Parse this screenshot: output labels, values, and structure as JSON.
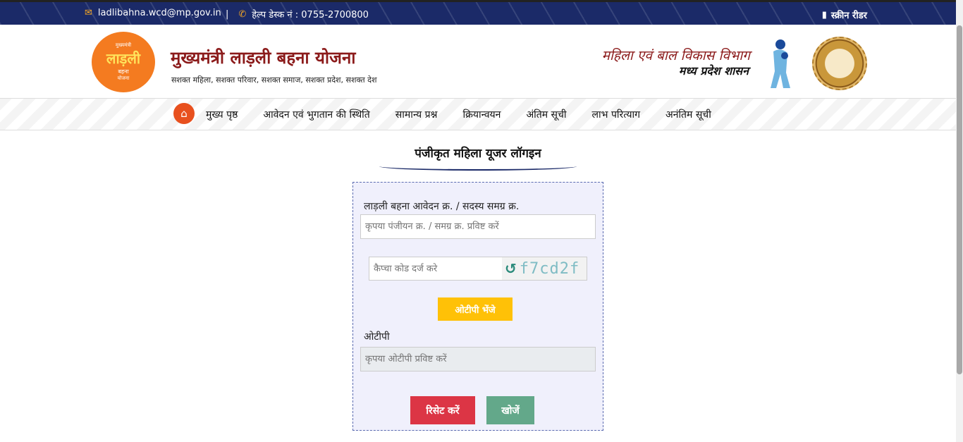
{
  "topbar": {
    "email_icon": "envelope-icon",
    "email": "ladlibahna.wcd@mp.gov.in",
    "separator": "|",
    "phone_icon": "phone-icon",
    "helpdesk": "हेल्प डेस्क नं : 0755-2700800",
    "screen_reader_icon": "book-icon",
    "screen_reader": "स्क्रीन रीडर",
    "background_color": "#1b2a68",
    "icon_color": "#f5a623"
  },
  "header": {
    "logo": {
      "line1": "मुख्यमंत्री",
      "line2": "लाड़ली",
      "line3": "बहना",
      "line4": "योजना"
    },
    "title": "मुख्यमंत्री लाड़ली बहना योजना",
    "tagline": "सशक्त महिला, सशक्त परिवार, सशक्त समाज, सशक्त प्रदेश, सशक्त देश",
    "dept_title": "महिला एवं बाल विकास विभाग",
    "dept_subtitle": "मध्य प्रदेश शासन",
    "title_color": "#8b1a1a",
    "logo_color": "#f47b20"
  },
  "nav": {
    "home_icon": "home-icon",
    "items": [
      "मुख्य पृष्ठ",
      "आवेदन एवं भुगतान की स्थिति",
      "सामान्य प्रश्न",
      "क्रियान्वयन",
      "अंतिम सूची",
      "लाभ परित्याग",
      "अनंतिम सूची"
    ],
    "home_color": "#e8501e"
  },
  "login": {
    "title": "पंजीकृत महिला यूजर लॉगइन",
    "reg_label": "लाड़ली बहना आवेदन क्र. / सदस्य समग्र क्र.",
    "reg_placeholder": "कृपया पंजीयन क्र. / समग्र क्र. प्रविष्ट करें",
    "captcha_placeholder": "कैप्चा कोड दर्ज करे",
    "captcha_refresh_icon": "refresh-icon",
    "captcha_text": "f7cd2f",
    "send_otp": "ओटीपी भेंजे",
    "otp_label": "ओटीपी",
    "otp_placeholder": "कृपया ओटीपी प्रविष्ट करें",
    "reset": "रिसेट करें",
    "search": "खोजें",
    "otp_button_color": "#ffc107",
    "reset_color": "#dc3545",
    "search_color": "#63a88a"
  }
}
